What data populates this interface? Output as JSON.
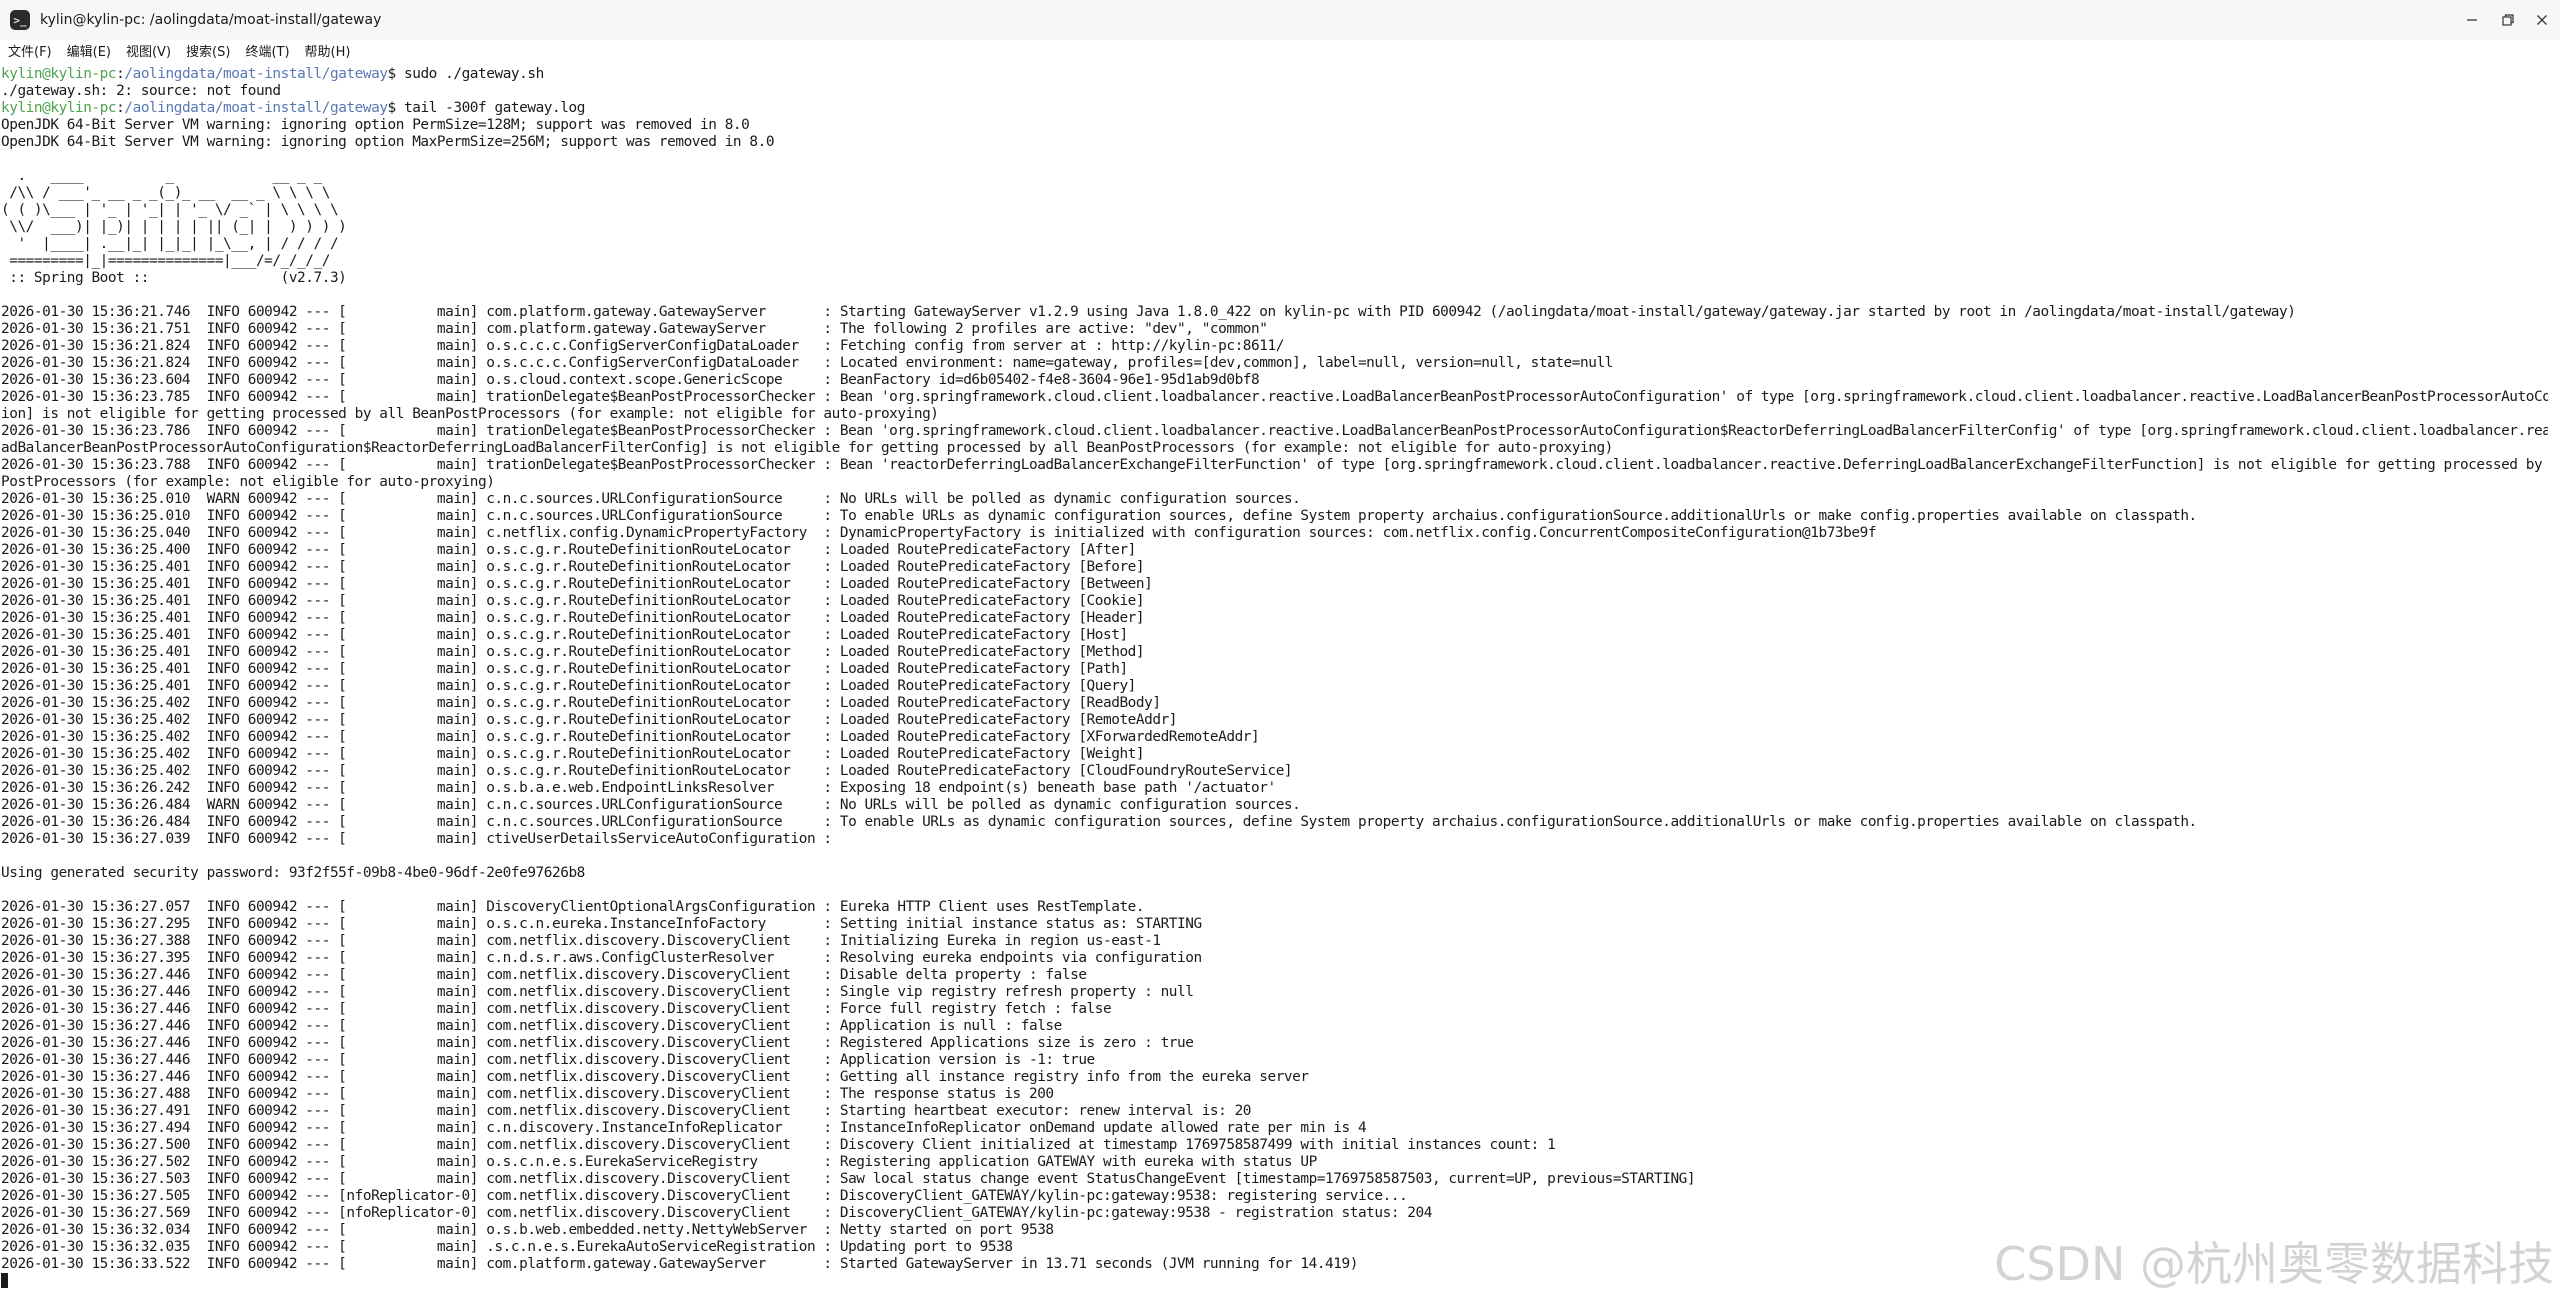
{
  "window": {
    "title": "kylin@kylin-pc: /aolingdata/moat-install/gateway",
    "app_icon_glyph": ">_",
    "controls": [
      "minimize-icon",
      "restore-icon",
      "close-icon"
    ]
  },
  "menu": [
    {
      "label": "文件(F)"
    },
    {
      "label": "编辑(E)"
    },
    {
      "label": "视图(V)"
    },
    {
      "label": "搜索(S)"
    },
    {
      "label": "终端(T)"
    },
    {
      "label": "帮助(H)"
    }
  ],
  "prompt": {
    "user_host": "kylin@kylin-pc",
    "path": "/aolingdata/moat-install/gateway",
    "symbol": "$",
    "user_color": "#4ea24e",
    "path_color": "#5a78b4"
  },
  "terminal": {
    "cmd1": " sudo ./gateway.sh",
    "out1": "./gateway.sh: 2: source: not found",
    "cmd2": " tail -300f gateway.log",
    "log": "OpenJDK 64-Bit Server VM warning: ignoring option PermSize=128M; support was removed in 8.0\nOpenJDK 64-Bit Server VM warning: ignoring option MaxPermSize=256M; support was removed in 8.0\n\n  .   ____          _            __ _ _\n /\\\\ / ___'_ __ _ _(_)_ __  __ _ \\ \\ \\ \\\n( ( )\\___ | '_ | '_| | '_ \\/ _` | \\ \\ \\ \\\n \\\\/  ___)| |_)| | | | | || (_| |  ) ) ) )\n  '  |____| .__|_| |_|_| |_\\__, | / / / /\n =========|_|==============|___/=/_/_/_/\n :: Spring Boot ::                (v2.7.3)\n\n2026-01-30 15:36:21.746  INFO 600942 --- [           main] com.platform.gateway.GatewayServer       : Starting GatewayServer v1.2.9 using Java 1.8.0_422 on kylin-pc with PID 600942 (/aolingdata/moat-install/gateway/gateway.jar started by root in /aolingdata/moat-install/gateway)\n2026-01-30 15:36:21.751  INFO 600942 --- [           main] com.platform.gateway.GatewayServer       : The following 2 profiles are active: \"dev\", \"common\"\n2026-01-30 15:36:21.824  INFO 600942 --- [           main] o.s.c.c.c.ConfigServerConfigDataLoader   : Fetching config from server at : http://kylin-pc:8611/\n2026-01-30 15:36:21.824  INFO 600942 --- [           main] o.s.c.c.c.ConfigServerConfigDataLoader   : Located environment: name=gateway, profiles=[dev,common], label=null, version=null, state=null\n2026-01-30 15:36:23.604  INFO 600942 --- [           main] o.s.cloud.context.scope.GenericScope     : BeanFactory id=d6b05402-f4e8-3604-96e1-95d1ab9d0bf8\n2026-01-30 15:36:23.785  INFO 600942 --- [           main] trationDelegate$BeanPostProcessorChecker : Bean 'org.springframework.cloud.client.loadbalancer.reactive.LoadBalancerBeanPostProcessorAutoConfiguration' of type [org.springframework.cloud.client.loadbalancer.reactive.LoadBalancerBeanPostProcessorAutoConfigurat\nion] is not eligible for getting processed by all BeanPostProcessors (for example: not eligible for auto-proxying)\n2026-01-30 15:36:23.786  INFO 600942 --- [           main] trationDelegate$BeanPostProcessorChecker : Bean 'org.springframework.cloud.client.loadbalancer.reactive.LoadBalancerBeanPostProcessorAutoConfiguration$ReactorDeferringLoadBalancerFilterConfig' of type [org.springframework.cloud.client.loadbalancer.reactive.Lo\nadBalancerBeanPostProcessorAutoConfiguration$ReactorDeferringLoadBalancerFilterConfig] is not eligible for getting processed by all BeanPostProcessors (for example: not eligible for auto-proxying)\n2026-01-30 15:36:23.788  INFO 600942 --- [           main] trationDelegate$BeanPostProcessorChecker : Bean 'reactorDeferringLoadBalancerExchangeFilterFunction' of type [org.springframework.cloud.client.loadbalancer.reactive.DeferringLoadBalancerExchangeFilterFunction] is not eligible for getting processed by all Bean\nPostProcessors (for example: not eligible for auto-proxying)\n2026-01-30 15:36:25.010  WARN 600942 --- [           main] c.n.c.sources.URLConfigurationSource     : No URLs will be polled as dynamic configuration sources.\n2026-01-30 15:36:25.010  INFO 600942 --- [           main] c.n.c.sources.URLConfigurationSource     : To enable URLs as dynamic configuration sources, define System property archaius.configurationSource.additionalUrls or make config.properties available on classpath.\n2026-01-30 15:36:25.040  INFO 600942 --- [           main] c.netflix.config.DynamicPropertyFactory  : DynamicPropertyFactory is initialized with configuration sources: com.netflix.config.ConcurrentCompositeConfiguration@1b73be9f\n2026-01-30 15:36:25.400  INFO 600942 --- [           main] o.s.c.g.r.RouteDefinitionRouteLocator    : Loaded RoutePredicateFactory [After]\n2026-01-30 15:36:25.401  INFO 600942 --- [           main] o.s.c.g.r.RouteDefinitionRouteLocator    : Loaded RoutePredicateFactory [Before]\n2026-01-30 15:36:25.401  INFO 600942 --- [           main] o.s.c.g.r.RouteDefinitionRouteLocator    : Loaded RoutePredicateFactory [Between]\n2026-01-30 15:36:25.401  INFO 600942 --- [           main] o.s.c.g.r.RouteDefinitionRouteLocator    : Loaded RoutePredicateFactory [Cookie]\n2026-01-30 15:36:25.401  INFO 600942 --- [           main] o.s.c.g.r.RouteDefinitionRouteLocator    : Loaded RoutePredicateFactory [Header]\n2026-01-30 15:36:25.401  INFO 600942 --- [           main] o.s.c.g.r.RouteDefinitionRouteLocator    : Loaded RoutePredicateFactory [Host]\n2026-01-30 15:36:25.401  INFO 600942 --- [           main] o.s.c.g.r.RouteDefinitionRouteLocator    : Loaded RoutePredicateFactory [Method]\n2026-01-30 15:36:25.401  INFO 600942 --- [           main] o.s.c.g.r.RouteDefinitionRouteLocator    : Loaded RoutePredicateFactory [Path]\n2026-01-30 15:36:25.401  INFO 600942 --- [           main] o.s.c.g.r.RouteDefinitionRouteLocator    : Loaded RoutePredicateFactory [Query]\n2026-01-30 15:36:25.402  INFO 600942 --- [           main] o.s.c.g.r.RouteDefinitionRouteLocator    : Loaded RoutePredicateFactory [ReadBody]\n2026-01-30 15:36:25.402  INFO 600942 --- [           main] o.s.c.g.r.RouteDefinitionRouteLocator    : Loaded RoutePredicateFactory [RemoteAddr]\n2026-01-30 15:36:25.402  INFO 600942 --- [           main] o.s.c.g.r.RouteDefinitionRouteLocator    : Loaded RoutePredicateFactory [XForwardedRemoteAddr]\n2026-01-30 15:36:25.402  INFO 600942 --- [           main] o.s.c.g.r.RouteDefinitionRouteLocator    : Loaded RoutePredicateFactory [Weight]\n2026-01-30 15:36:25.402  INFO 600942 --- [           main] o.s.c.g.r.RouteDefinitionRouteLocator    : Loaded RoutePredicateFactory [CloudFoundryRouteService]\n2026-01-30 15:36:26.242  INFO 600942 --- [           main] o.s.b.a.e.web.EndpointLinksResolver      : Exposing 18 endpoint(s) beneath base path '/actuator'\n2026-01-30 15:36:26.484  WARN 600942 --- [           main] c.n.c.sources.URLConfigurationSource     : No URLs will be polled as dynamic configuration sources.\n2026-01-30 15:36:26.484  INFO 600942 --- [           main] c.n.c.sources.URLConfigurationSource     : To enable URLs as dynamic configuration sources, define System property archaius.configurationSource.additionalUrls or make config.properties available on classpath.\n2026-01-30 15:36:27.039  INFO 600942 --- [           main] ctiveUserDetailsServiceAutoConfiguration :\n\nUsing generated security password: 93f2f55f-09b8-4be0-96df-2e0fe97626b8\n\n2026-01-30 15:36:27.057  INFO 600942 --- [           main] DiscoveryClientOptionalArgsConfiguration : Eureka HTTP Client uses RestTemplate.\n2026-01-30 15:36:27.295  INFO 600942 --- [           main] o.s.c.n.eureka.InstanceInfoFactory       : Setting initial instance status as: STARTING\n2026-01-30 15:36:27.388  INFO 600942 --- [           main] com.netflix.discovery.DiscoveryClient    : Initializing Eureka in region us-east-1\n2026-01-30 15:36:27.395  INFO 600942 --- [           main] c.n.d.s.r.aws.ConfigClusterResolver      : Resolving eureka endpoints via configuration\n2026-01-30 15:36:27.446  INFO 600942 --- [           main] com.netflix.discovery.DiscoveryClient    : Disable delta property : false\n2026-01-30 15:36:27.446  INFO 600942 --- [           main] com.netflix.discovery.DiscoveryClient    : Single vip registry refresh property : null\n2026-01-30 15:36:27.446  INFO 600942 --- [           main] com.netflix.discovery.DiscoveryClient    : Force full registry fetch : false\n2026-01-30 15:36:27.446  INFO 600942 --- [           main] com.netflix.discovery.DiscoveryClient    : Application is null : false\n2026-01-30 15:36:27.446  INFO 600942 --- [           main] com.netflix.discovery.DiscoveryClient    : Registered Applications size is zero : true\n2026-01-30 15:36:27.446  INFO 600942 --- [           main] com.netflix.discovery.DiscoveryClient    : Application version is -1: true\n2026-01-30 15:36:27.446  INFO 600942 --- [           main] com.netflix.discovery.DiscoveryClient    : Getting all instance registry info from the eureka server\n2026-01-30 15:36:27.488  INFO 600942 --- [           main] com.netflix.discovery.DiscoveryClient    : The response status is 200\n2026-01-30 15:36:27.491  INFO 600942 --- [           main] com.netflix.discovery.DiscoveryClient    : Starting heartbeat executor: renew interval is: 20\n2026-01-30 15:36:27.494  INFO 600942 --- [           main] c.n.discovery.InstanceInfoReplicator     : InstanceInfoReplicator onDemand update allowed rate per min is 4\n2026-01-30 15:36:27.500  INFO 600942 --- [           main] com.netflix.discovery.DiscoveryClient    : Discovery Client initialized at timestamp 1769758587499 with initial instances count: 1\n2026-01-30 15:36:27.502  INFO 600942 --- [           main] o.s.c.n.e.s.EurekaServiceRegistry        : Registering application GATEWAY with eureka with status UP\n2026-01-30 15:36:27.503  INFO 600942 --- [           main] com.netflix.discovery.DiscoveryClient    : Saw local status change event StatusChangeEvent [timestamp=1769758587503, current=UP, previous=STARTING]\n2026-01-30 15:36:27.505  INFO 600942 --- [nfoReplicator-0] com.netflix.discovery.DiscoveryClient    : DiscoveryClient_GATEWAY/kylin-pc:gateway:9538: registering service...\n2026-01-30 15:36:27.569  INFO 600942 --- [nfoReplicator-0] com.netflix.discovery.DiscoveryClient    : DiscoveryClient_GATEWAY/kylin-pc:gateway:9538 - registration status: 204\n2026-01-30 15:36:32.034  INFO 600942 --- [           main] o.s.b.web.embedded.netty.NettyWebServer  : Netty started on port 9538\n2026-01-30 15:36:32.035  INFO 600942 --- [           main] .s.c.n.e.s.EurekaAutoServiceRegistration : Updating port to 9538\n2026-01-30 15:36:33.522  INFO 600942 --- [           main] com.platform.gateway.GatewayServer       : Started GatewayServer in 13.71 seconds (JVM running for 14.419)"
  },
  "watermark": "CSDN @杭州奥零数据科技"
}
